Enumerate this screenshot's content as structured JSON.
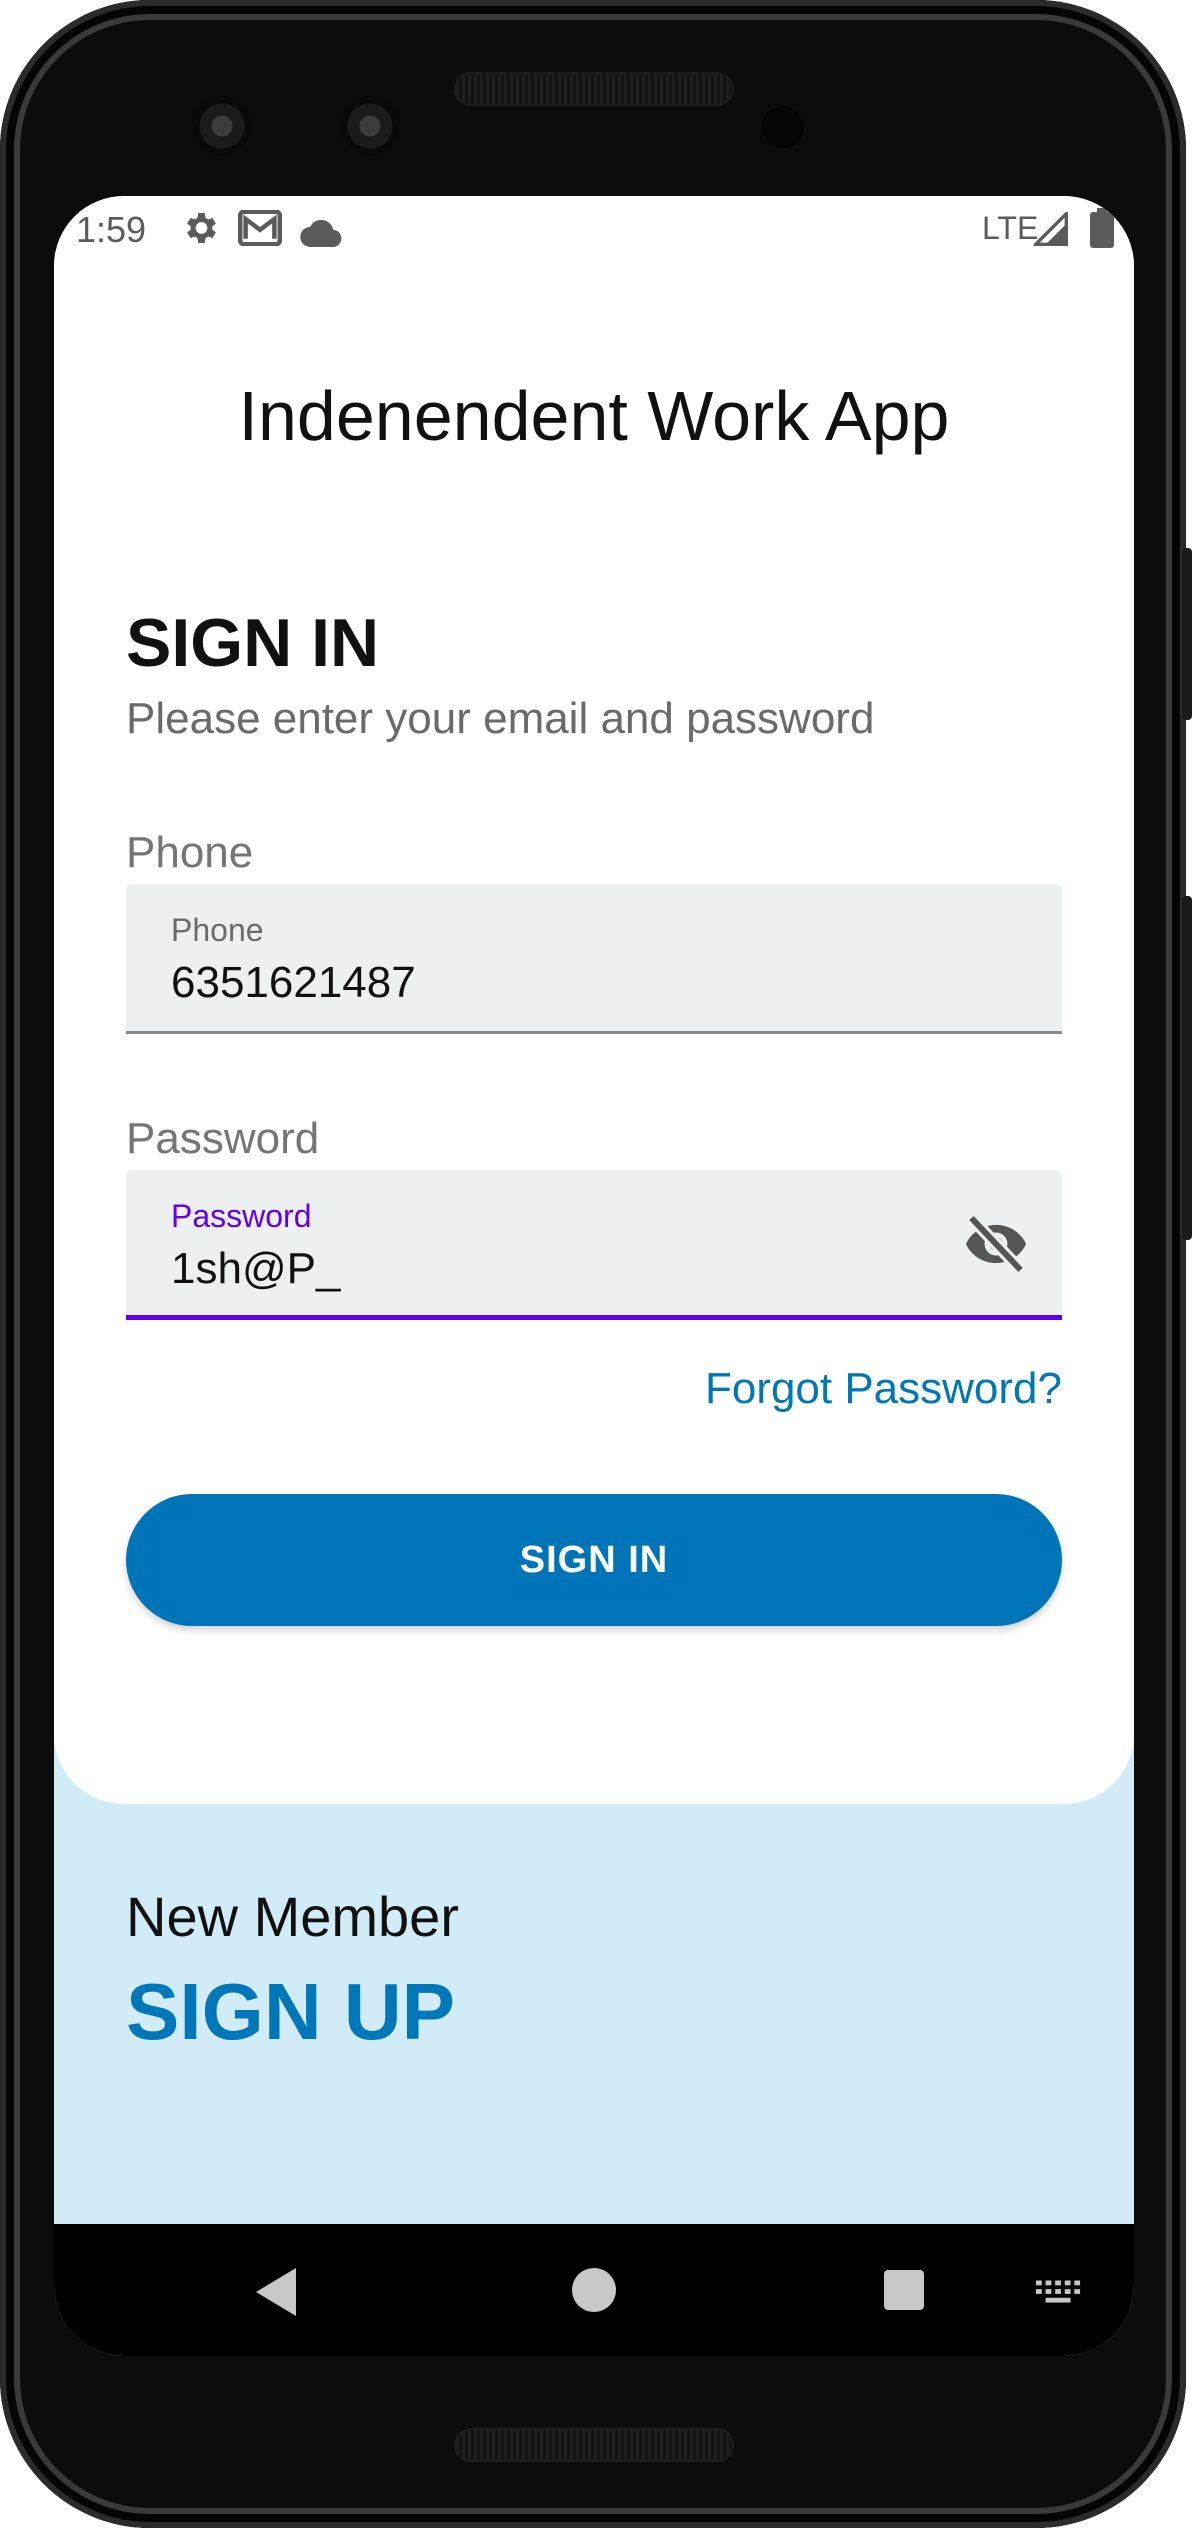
{
  "status_bar": {
    "time": "1:59",
    "icons": [
      "settings-icon",
      "mail-icon",
      "cloud-icon"
    ],
    "network": "LTE",
    "right_icons": [
      "signal-icon",
      "battery-icon"
    ]
  },
  "app": {
    "title": "Indenendent Work App"
  },
  "sign_in": {
    "heading": "SIGN IN",
    "subtitle": "Please enter your email and password",
    "phone": {
      "label": "Phone",
      "floating_label": "Phone",
      "value": "6351621487"
    },
    "password": {
      "label": "Password",
      "floating_label": "Password",
      "value": "1sh@P_",
      "visibility_icon": "eye-off-icon"
    },
    "forgot_password": "Forgot Password?",
    "button_label": "SIGN IN"
  },
  "sign_up": {
    "prompt": "New Member",
    "link_label": "SIGN UP"
  },
  "nav_bar": {
    "icons": [
      "back-icon",
      "home-icon",
      "recents-icon",
      "keyboard-icon"
    ]
  },
  "colors": {
    "accent": "#0074b8",
    "focus": "#6200ee",
    "signup_bg": "#d2ecf7",
    "field_bg": "#edf0f1"
  }
}
